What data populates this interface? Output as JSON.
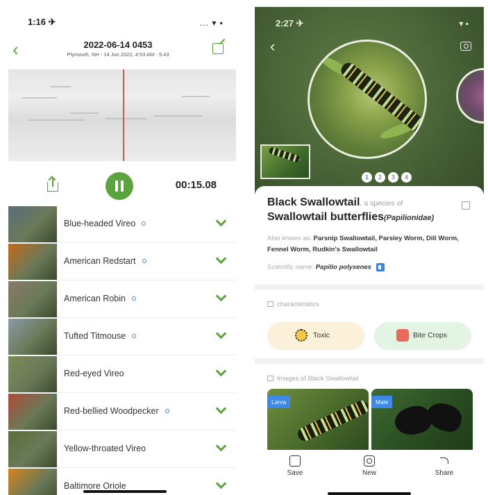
{
  "left": {
    "status": {
      "time": "1:16 ✈",
      "signal": "... ▾ ▪"
    },
    "recording": {
      "title": "2022-06-14 0453",
      "subtitle": "Plymouth, NH - 14 Jun 2022, 4:53 AM - 5:43"
    },
    "player": {
      "elapsed": "00:15.08"
    },
    "species": [
      {
        "name": "Blue-headed Vireo",
        "info": true,
        "thumb_color": "#5a6e7a"
      },
      {
        "name": "American Redstart",
        "info": true,
        "thumb_color": "#c36a1a"
      },
      {
        "name": "American Robin",
        "info": true,
        "thumb_color": "#8a7a6a"
      },
      {
        "name": "Tufted Titmouse",
        "info": true,
        "thumb_color": "#8b9aa8"
      },
      {
        "name": "Red-eyed Vireo",
        "info": false,
        "thumb_color": "#7c8a56"
      },
      {
        "name": "Red-bellied Woodpecker",
        "info": true,
        "thumb_color": "#b04a3a"
      },
      {
        "name": "Yellow-throated Vireo",
        "info": false,
        "thumb_color": "#5b6e3a"
      },
      {
        "name": "Baltimore Oriole",
        "info": false,
        "thumb_color": "#d6841a"
      }
    ]
  },
  "right": {
    "status": {
      "time": "2:27 ✈",
      "signal": "▾ ▪"
    },
    "pager": [
      "1",
      "2",
      "3",
      "4"
    ],
    "species": {
      "name": "Black Swallowtail",
      "connector": ", a species of",
      "group": "Swallowtail butterflies",
      "family": "(Papilionidae)"
    },
    "aka": {
      "label": "Also known as:",
      "value": "Parsnip Swallowtail, Parsley Worm, Dill Worm, Fennel Worm, Rudkin's Swallowtail"
    },
    "scientific": {
      "label": "Scientific name:",
      "value": "Papilio polyxenes"
    },
    "characteristics": {
      "title": "characteristics",
      "items": [
        "Toxic",
        "Bite Crops"
      ]
    },
    "images": {
      "title": "Images of Black Swallowtail",
      "tags": [
        "Larva",
        "Male"
      ]
    },
    "bottom": {
      "save": "Save",
      "new": "New",
      "share": "Share"
    }
  }
}
